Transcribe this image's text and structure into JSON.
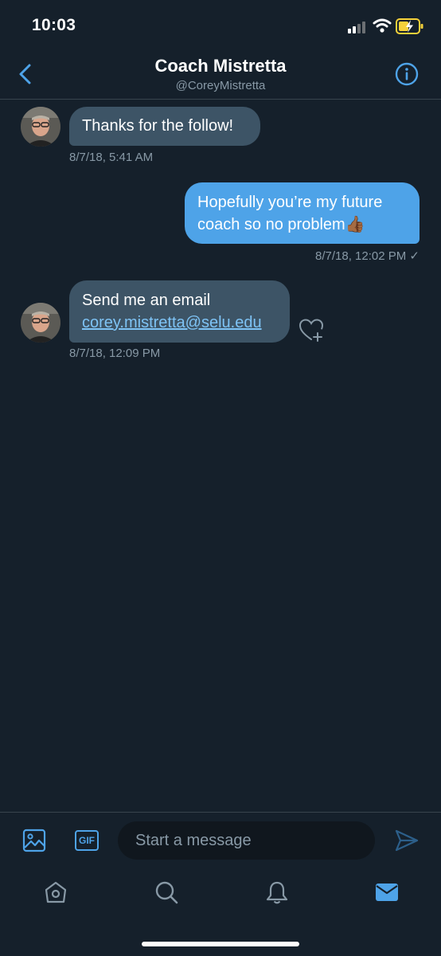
{
  "status_bar": {
    "time": "10:03"
  },
  "header": {
    "title": "Coach Mistretta",
    "handle": "@CoreyMistretta"
  },
  "messages": [
    {
      "direction": "received",
      "text": "Thanks for the follow!",
      "timestamp": "8/7/18, 5:41 AM"
    },
    {
      "direction": "sent",
      "line1": "Hopefully you’re my future",
      "line2": "coach so no problem",
      "emoji": "👍🏾",
      "timestamp": "8/7/18, 12:02 PM ✓"
    },
    {
      "direction": "received",
      "line1": "Send me an email",
      "link": "corey.mistretta@selu.edu",
      "timestamp": "8/7/18, 12:09 PM"
    }
  ],
  "composer": {
    "gif_label": "GIF",
    "placeholder": "Start a message"
  },
  "tabs": [
    "home-icon",
    "search-icon",
    "bell-icon",
    "mail-icon"
  ],
  "colors": {
    "background": "#15202b",
    "accent": "#4ea3e8",
    "received_bubble": "#3d5466",
    "muted_text": "#8899a6",
    "divider": "#38444d",
    "battery_charging": "#f5d13a"
  }
}
